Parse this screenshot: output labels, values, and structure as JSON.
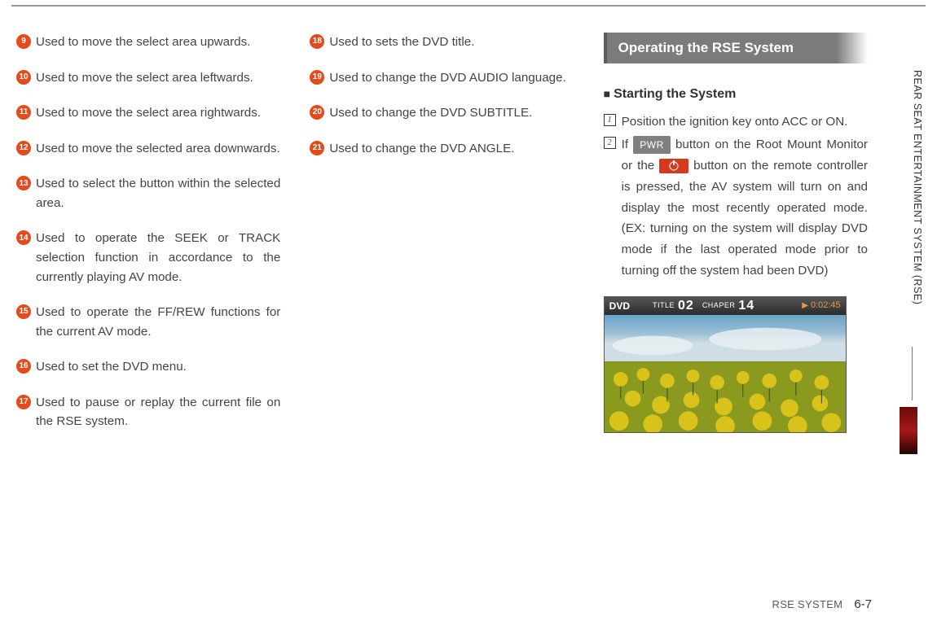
{
  "side_label": "REAR SEAT ENTERTAINMENT SYSTEM (RSE)",
  "footer": {
    "section": "RSE SYSTEM",
    "page": "6-7"
  },
  "col1": [
    {
      "n": "9",
      "text": "Used to move the select area upwards."
    },
    {
      "n": "10",
      "text": "Used to move the select area leftwards."
    },
    {
      "n": "11",
      "text": "Used to move the select area rightwards."
    },
    {
      "n": "12",
      "text": "Used to move the selected area downwards."
    },
    {
      "n": "13",
      "text": "Used to select the button within the selected area."
    },
    {
      "n": "14",
      "text": "Used to operate the SEEK or TRACK selection function in accordance to the currently playing AV mode."
    },
    {
      "n": "15",
      "text": "Used to operate the FF/REW functions for the current AV mode."
    },
    {
      "n": "16",
      "text": "Used to set the DVD menu."
    },
    {
      "n": "17",
      "text": "Used to pause or replay the current file on the RSE system."
    }
  ],
  "col2": [
    {
      "n": "18",
      "text": "Used to sets the DVD title."
    },
    {
      "n": "19",
      "text": "Used to change the DVD AUDIO language."
    },
    {
      "n": "20",
      "text": "Used to change the DVD SUBTITLE."
    },
    {
      "n": "21",
      "text": "Used to change the DVD ANGLE."
    }
  ],
  "col3": {
    "section_title": "Operating the RSE System",
    "sub_title": "Starting the System",
    "step1": "Position the ignition key onto ACC or ON.",
    "step2_a": "If ",
    "step2_key": "PWR",
    "step2_b": " button on the Root Mount Monitor or the ",
    "step2_c": " button on the remote controller is pressed, the AV system will turn on and display the most recently operated mode. (EX: turning on the system will display DVD  mode if the last operated mode prior to turning off the system had been DVD)"
  },
  "dvd": {
    "mode": "DVD",
    "title_label": "TITLE",
    "title_num": "02",
    "chapter_label": "CHAPER",
    "chapter_num": "14",
    "time": "0:02:45"
  }
}
